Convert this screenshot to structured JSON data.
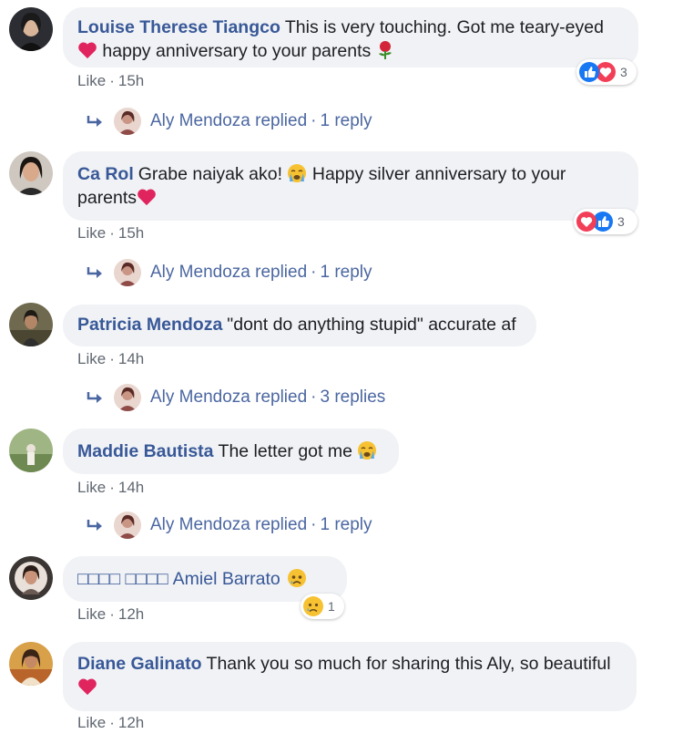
{
  "colors": {
    "author": "#385898",
    "meta": "#606770",
    "reply_link": "#4b67a1",
    "bubble_bg": "#f0f2f5",
    "heart": "#e0245e",
    "like_blue": "#1877f2"
  },
  "comments": [
    {
      "author": "Louise Therese Tiangco",
      "text_a": "This is very touching. Got me teary-eyed",
      "text_b": "happy anniversary to your parents",
      "like": "Like",
      "dot": "·",
      "time": "15h",
      "reaction_count": "3",
      "reply": {
        "name": "Aly Mendoza replied",
        "dot": "·",
        "count": "1 reply"
      }
    },
    {
      "author": "Ca Rol",
      "text_a": "Grabe naiyak ako!",
      "text_b": "Happy silver anniversary to your",
      "text_c": "parents",
      "like": "Like",
      "dot": "·",
      "time": "15h",
      "reaction_count": "3",
      "reply": {
        "name": "Aly Mendoza replied",
        "dot": "·",
        "count": "1 reply"
      }
    },
    {
      "author": "Patricia Mendoza",
      "text_a": "\"dont do anything stupid\" accurate af",
      "like": "Like",
      "dot": "·",
      "time": "14h",
      "reply": {
        "name": "Aly Mendoza replied",
        "dot": "·",
        "count": "3 replies"
      }
    },
    {
      "author": "Maddie Bautista",
      "text_a": "The letter got me",
      "like": "Like",
      "dot": "·",
      "time": "14h",
      "reply": {
        "name": "Aly Mendoza replied",
        "dot": "·",
        "count": "1 reply"
      }
    },
    {
      "author_prefix": "□□□□ □□□□",
      "text_a": "Amiel Barrato",
      "like": "Like",
      "dot": "·",
      "time": "12h",
      "reaction_count": "1"
    },
    {
      "author": "Diane Galinato",
      "text_a": "Thank you so much for sharing this Aly, so beautiful",
      "like": "Like",
      "dot": "·",
      "time": "12h"
    }
  ]
}
